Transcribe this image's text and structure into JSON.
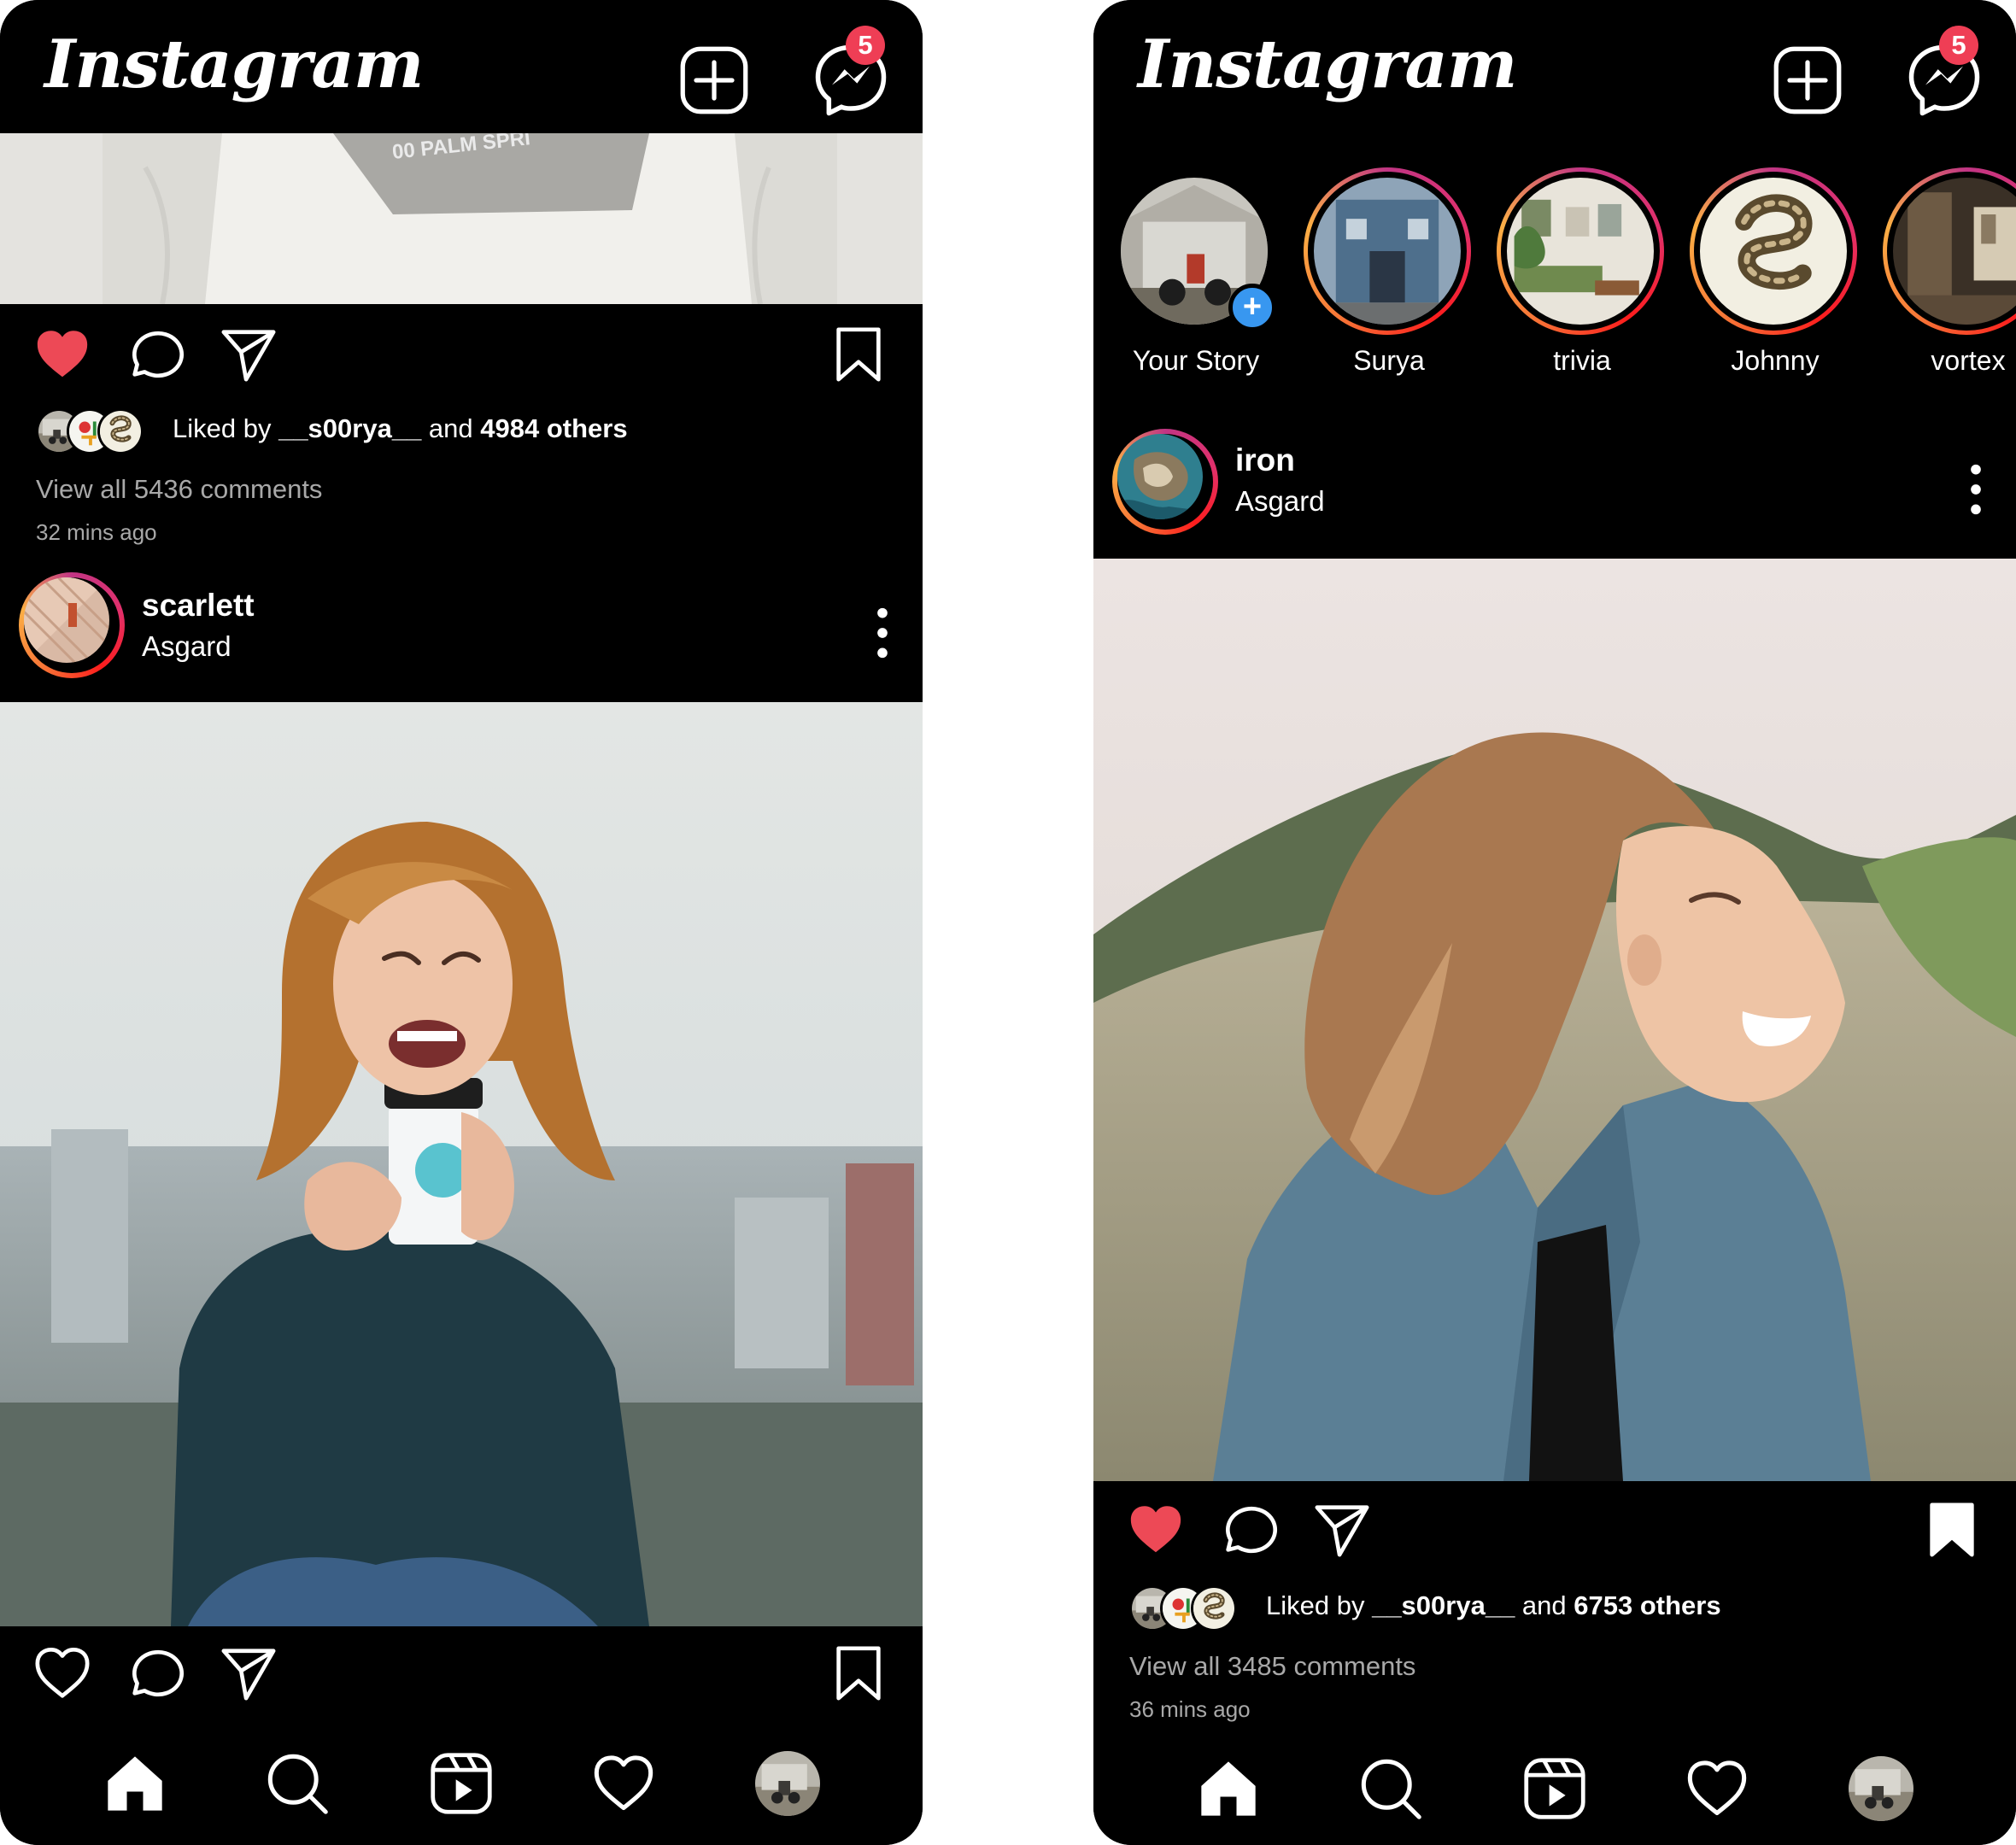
{
  "app": {
    "name": "Instagram",
    "unread_messages": "5"
  },
  "left_screen": {
    "prev_post": {
      "shirt_print": "00 PALM SPRI",
      "liked": true,
      "saved": false,
      "liked_prefix": "Liked by ",
      "liked_user": "__s00rya__",
      "liked_mid": " and ",
      "liked_count": "4984 others",
      "comments": "View all 5436 comments",
      "time": "32 mins ago"
    },
    "post": {
      "username": "scarlett",
      "location": "Asgard",
      "liked": false,
      "saved": false
    }
  },
  "right_screen": {
    "stories": [
      {
        "name": "Your Story",
        "own": true
      },
      {
        "name": "Surya"
      },
      {
        "name": "trivia"
      },
      {
        "name": "Johnny"
      },
      {
        "name": "vortex"
      }
    ],
    "post": {
      "username": "iron",
      "location": "Asgard",
      "liked": true,
      "saved": true,
      "liked_prefix": "Liked by ",
      "liked_user": "__s00rya__",
      "liked_mid": " and ",
      "liked_count": "6753 others",
      "comments": "View all 3485 comments",
      "time": "36 mins ago"
    }
  },
  "nav_items": [
    "home-icon",
    "search-icon",
    "reels-icon",
    "activity-icon",
    "profile-avatar"
  ],
  "colors": {
    "like_red": "#ed4956",
    "badge_red": "#ef3e55",
    "story_blue": "#3897f0"
  }
}
